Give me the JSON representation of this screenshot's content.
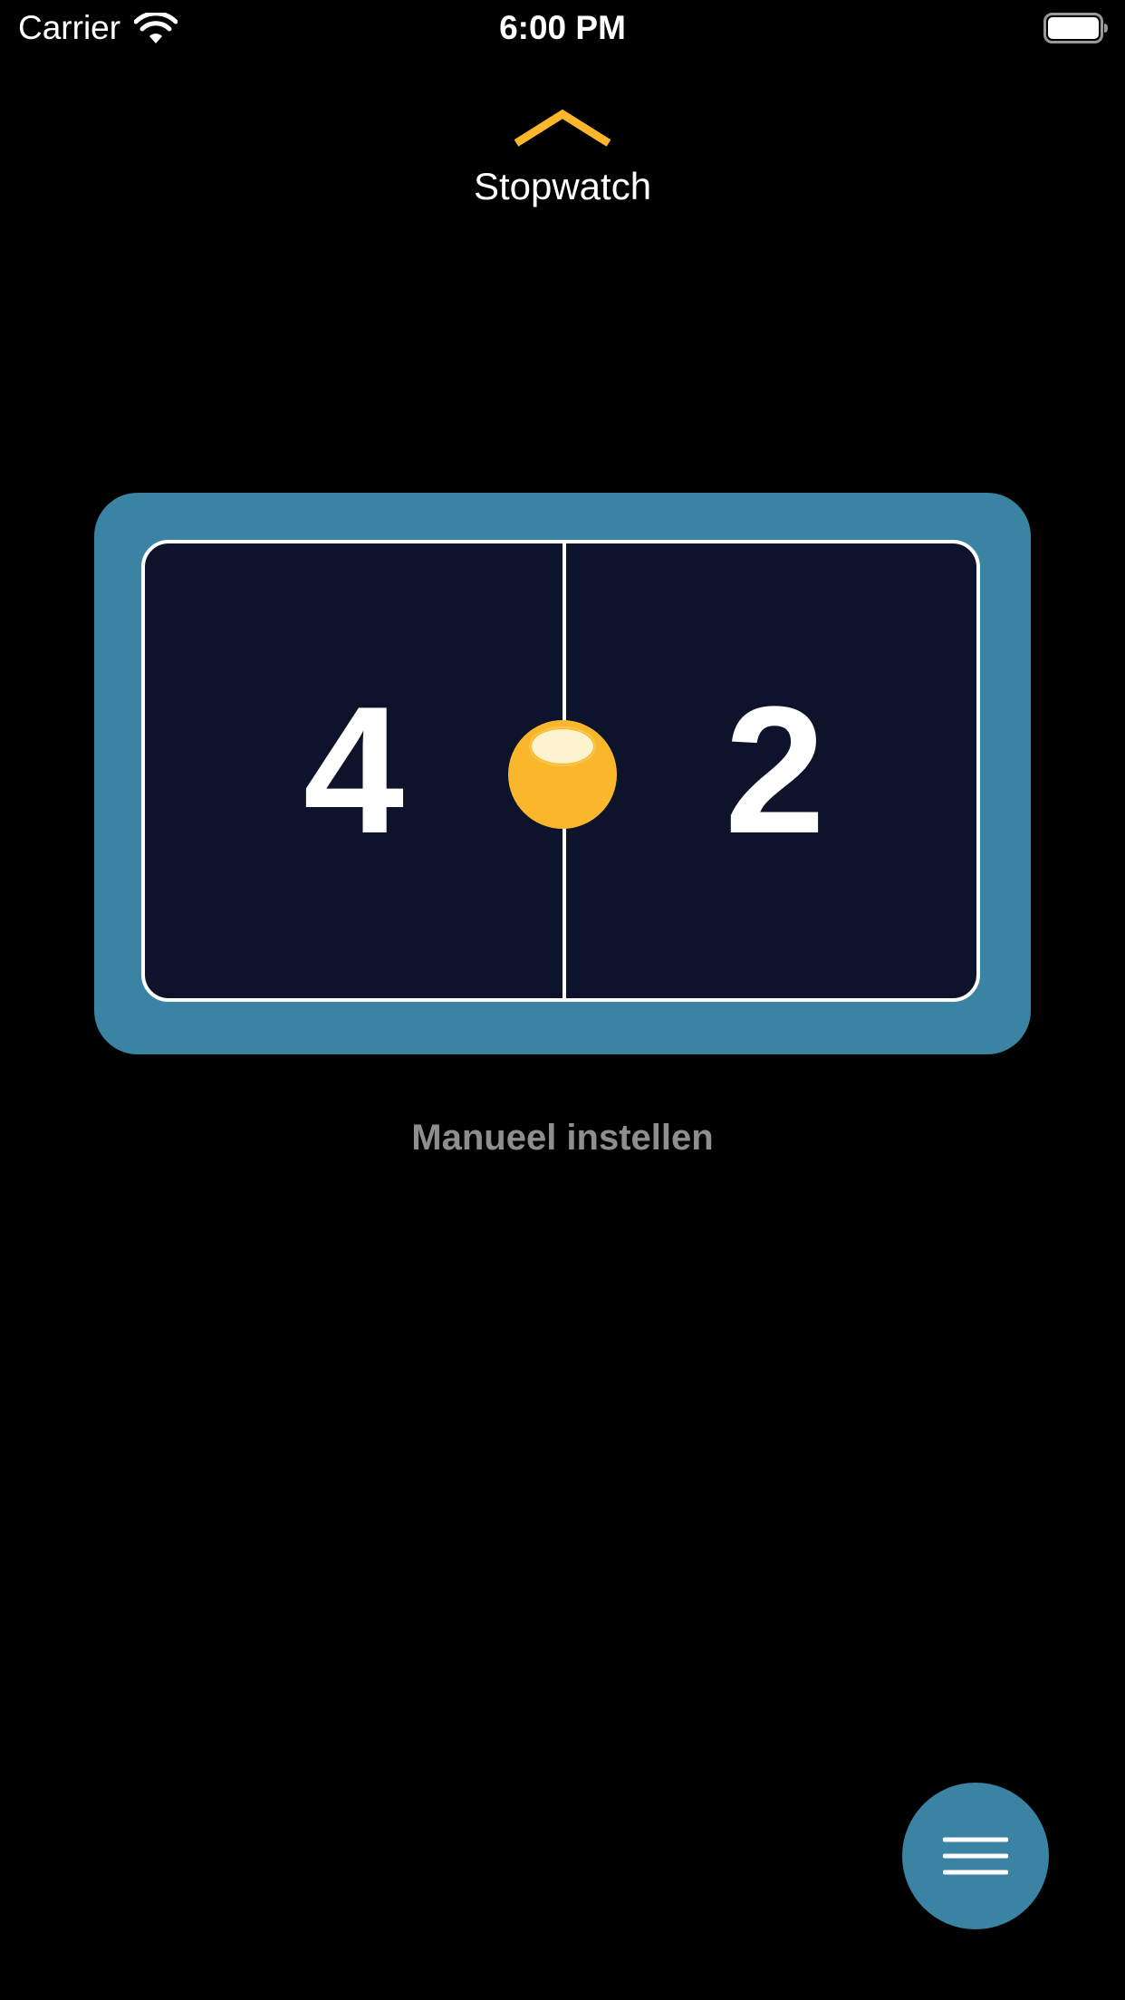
{
  "status_bar": {
    "carrier": "Carrier",
    "time": "6:00 PM",
    "wifi_icon": "wifi-icon",
    "battery_icon": "battery-icon"
  },
  "header": {
    "pull_icon": "chevron-up-icon",
    "label": "Stopwatch"
  },
  "scoreboard": {
    "home_score": "4",
    "away_score": "2",
    "serve_indicator": "ball-icon"
  },
  "manual_label": "Manueel instellen",
  "menu_button": {
    "icon": "menu-icon"
  },
  "colors": {
    "background": "#000000",
    "accent": "#fbb72c",
    "board_frame": "#3b83a3",
    "court": "#0c132a",
    "muted_text": "#8e8e8e"
  }
}
